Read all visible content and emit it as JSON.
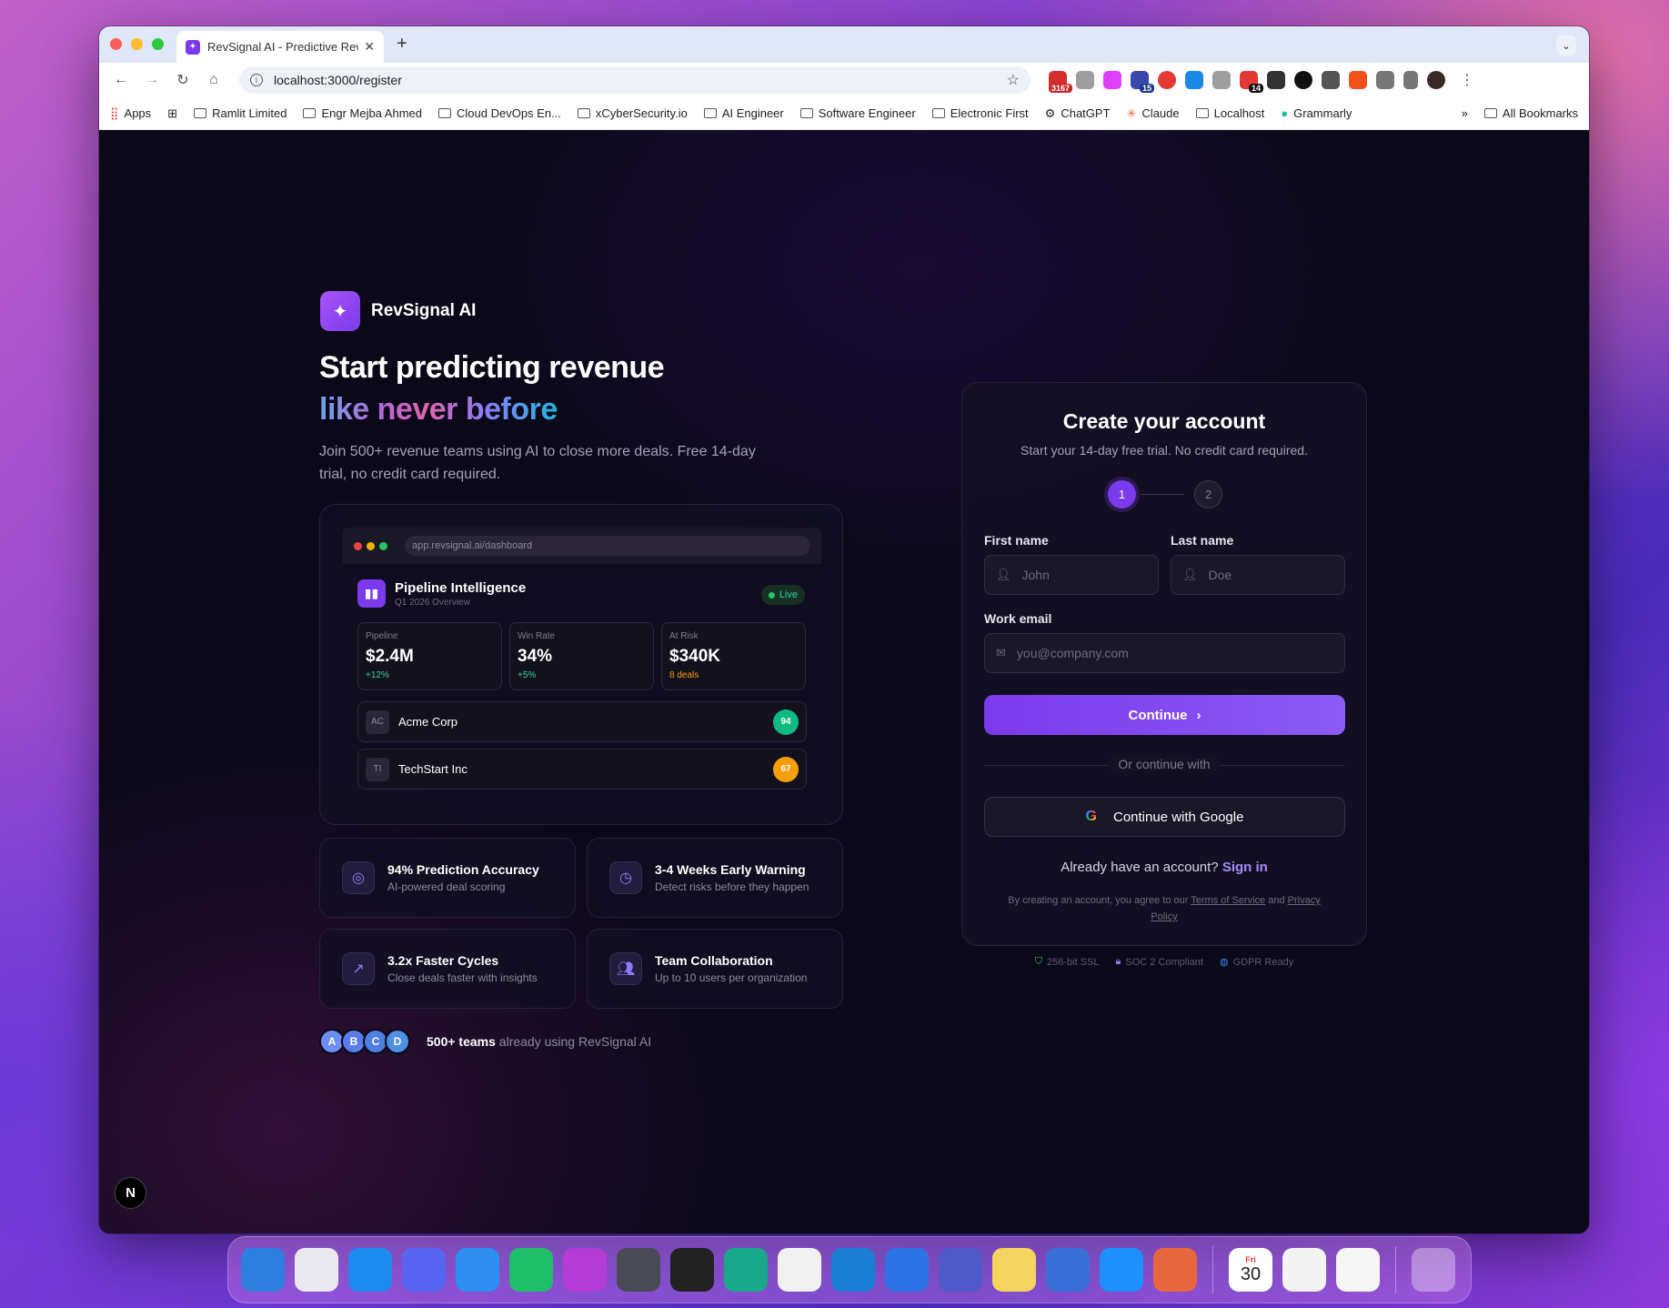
{
  "browser": {
    "tab_title": "RevSignal AI - Predictive Reve",
    "url": "localhost:3000/register",
    "extension_badges": {
      "gmail": "3167",
      "ext_15": "15",
      "ext_14": "14"
    },
    "bookmarks": [
      {
        "label": "Apps",
        "icon": "apps-grid-icon"
      },
      {
        "label": "Ramlit Limited",
        "icon": "folder-icon"
      },
      {
        "label": "Engr Mejba Ahmed",
        "icon": "folder-icon"
      },
      {
        "label": "Cloud DevOps En...",
        "icon": "folder-icon"
      },
      {
        "label": "xCyberSecurity.io",
        "icon": "folder-icon"
      },
      {
        "label": "AI Engineer",
        "icon": "folder-icon"
      },
      {
        "label": "Software Engineer",
        "icon": "folder-icon"
      },
      {
        "label": "Electronic First",
        "icon": "folder-icon"
      },
      {
        "label": "ChatGPT",
        "icon": "chatgpt-icon"
      },
      {
        "label": "Claude",
        "icon": "claude-icon"
      },
      {
        "label": "Localhost",
        "icon": "folder-icon"
      },
      {
        "label": "Grammarly",
        "icon": "grammarly-icon"
      }
    ],
    "all_bookmarks": "All Bookmarks"
  },
  "hero": {
    "brand": "RevSignal AI",
    "headline_line1": "Start predicting revenue",
    "headline_line2": "like never before",
    "subtext": "Join 500+ revenue teams using AI to close more deals. Free 14-day trial, no credit card required."
  },
  "preview": {
    "url": "app.revsignal.ai/dashboard",
    "title": "Pipeline Intelligence",
    "subtitle": "Q1 2026 Overview",
    "live_label": "Live",
    "stats": [
      {
        "label": "Pipeline",
        "value": "$2.4M",
        "change": "+12%",
        "change_color": "#34d399"
      },
      {
        "label": "Win Rate",
        "value": "34%",
        "change": "+5%",
        "change_color": "#34d399"
      },
      {
        "label": "At Risk",
        "value": "$340K",
        "change": "8 deals",
        "change_color": "#f59e0b"
      }
    ],
    "deals": [
      {
        "initials": "AC",
        "name": "Acme Corp",
        "score": "94",
        "score_color": "#10b981"
      },
      {
        "initials": "TI",
        "name": "TechStart Inc",
        "score": "67",
        "score_color": "#f59e0b"
      }
    ]
  },
  "features": [
    {
      "icon": "target-icon",
      "title": "94% Prediction Accuracy",
      "desc": "AI-powered deal scoring"
    },
    {
      "icon": "clock-icon",
      "title": "3-4 Weeks Early Warning",
      "desc": "Detect risks before they happen"
    },
    {
      "icon": "trending-up-icon",
      "title": "3.2x Faster Cycles",
      "desc": "Close deals faster with insights"
    },
    {
      "icon": "users-icon",
      "title": "Team Collaboration",
      "desc": "Up to 10 users per organization"
    }
  ],
  "social_proof": {
    "avatars": [
      "A",
      "B",
      "C",
      "D"
    ],
    "strong": "500+ teams",
    "rest": " already using RevSignal AI"
  },
  "form": {
    "title": "Create your account",
    "subtitle": "Start your 14-day free trial. No credit card required.",
    "steps": [
      "1",
      "2"
    ],
    "active_step": 1,
    "first_name_label": "First name",
    "first_name_placeholder": "John",
    "last_name_label": "Last name",
    "last_name_placeholder": "Doe",
    "email_label": "Work email",
    "email_placeholder": "you@company.com",
    "continue_label": "Continue",
    "divider": "Or continue with",
    "google_label": "Continue with Google",
    "signin_prompt": "Already have an account?",
    "signin_link": "Sign in",
    "legal_prefix": "By creating an account, you agree to our",
    "terms": "Terms of Service",
    "legal_and": "and",
    "privacy": "Privacy Policy"
  },
  "trust": [
    "256-bit SSL",
    "SOC 2 Compliant",
    "GDPR Ready"
  ],
  "dock": {
    "apps": [
      "Finder",
      "Launchpad",
      "App Store",
      "Discord",
      "Safari",
      "PyCharm",
      "PhpStorm",
      "Xcode",
      "Cursor",
      "DataGrip",
      "Chrome",
      "VS Code",
      "Instruments",
      "Teams",
      "Notes",
      "Simulator",
      "QuickTime",
      "Claude"
    ],
    "calendar_day": "Fri",
    "calendar_date": "30"
  }
}
